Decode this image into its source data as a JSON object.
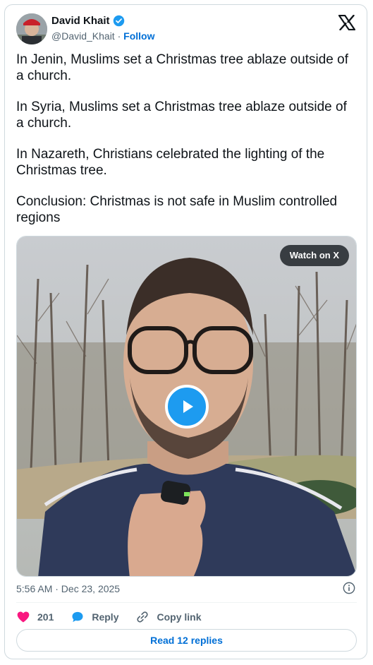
{
  "author": {
    "name": "David Khait",
    "handle": "@David_Khait",
    "separator": " · ",
    "follow_label": "Follow"
  },
  "tweet": {
    "paragraphs": [
      "In Jenin, Muslims set a Christmas tree ablaze outside of a church.",
      "In Syria, Muslims set a Christmas tree ablaze outside of a church.",
      "In Nazareth, Christians celebrated the lighting of the Christmas tree.",
      "Conclusion: Christmas is not safe in Muslim controlled regions"
    ]
  },
  "media": {
    "watch_label": "Watch on X"
  },
  "meta": {
    "timestamp": "5:56 AM · Dec 23, 2025"
  },
  "actions": {
    "like_count": "201",
    "reply_label": "Reply",
    "copy_label": "Copy link"
  },
  "footer": {
    "read_replies_label": "Read 12 replies"
  },
  "icons": {
    "verified": "verified-badge-icon",
    "brand": "x-logo-icon",
    "like": "heart-icon",
    "reply": "speech-bubble-icon",
    "copy": "link-icon",
    "info": "info-icon",
    "play": "play-icon"
  },
  "colors": {
    "accent": "#1d9bf0",
    "link": "#006fd6",
    "like": "#f91880",
    "muted": "#536471",
    "border": "#cfd9de"
  }
}
